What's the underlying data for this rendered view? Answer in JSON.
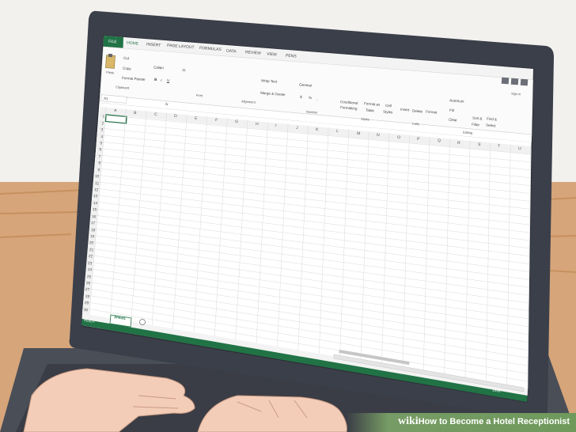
{
  "ribbon_tabs": [
    "FILE",
    "HOME",
    "INSERT",
    "PAGE LAYOUT",
    "FORMULAS",
    "DATA",
    "REVIEW",
    "VIEW",
    "PENS"
  ],
  "sign_in": "Sign in",
  "clipboard": {
    "paste": "Paste",
    "cut": "Cut",
    "copy": "Copy",
    "format_painter": "Format Painter",
    "group": "Clipboard"
  },
  "font": {
    "name": "Calibri",
    "size": "11",
    "group": "Font",
    "bold": "B",
    "italic": "I",
    "underline": "U"
  },
  "alignment": {
    "wrap_text": "Wrap Text",
    "merge_center": "Merge & Center",
    "group": "Alignment"
  },
  "number": {
    "format": "General",
    "currency": "$",
    "percent": "%",
    "comma": ",",
    "group": "Number"
  },
  "styles": {
    "conditional": "Conditional",
    "formatting": "Formatting",
    "format_as": "Format as",
    "table": "Table",
    "cell": "Cell",
    "cell_styles": "Styles",
    "group": "Styles"
  },
  "cells": {
    "insert": "Insert",
    "delete": "Delete",
    "format": "Format",
    "group": "Cells"
  },
  "editing": {
    "autosum": "AutoSum",
    "fill": "Fill",
    "clear": "Clear",
    "sort": "Sort &",
    "filter": "Filter",
    "find": "Find &",
    "select": "Select",
    "group": "Editing"
  },
  "name_box": "A1",
  "fx": "fx",
  "columns": [
    "A",
    "B",
    "C",
    "D",
    "E",
    "F",
    "G",
    "H",
    "I",
    "J",
    "K",
    "L",
    "M",
    "N",
    "O",
    "P",
    "Q",
    "R",
    "S",
    "T",
    "U"
  ],
  "rows": [
    "1",
    "2",
    "3",
    "4",
    "5",
    "6",
    "7",
    "8",
    "9",
    "10",
    "11",
    "12",
    "13",
    "14",
    "15",
    "16",
    "17",
    "18",
    "19",
    "20",
    "21",
    "22",
    "23",
    "24",
    "25",
    "26",
    "27",
    "28",
    "29",
    "30"
  ],
  "sheet_tab": "Sheet1",
  "status": "READY",
  "zoom": "100%",
  "watermark": {
    "wiki": "wiki",
    "title": "How to Become a Hotel Receptionist"
  },
  "colors": {
    "excel_green": "#217346",
    "laptop_bezel": "#3b3f4a",
    "desk": "#d6a57a",
    "wall": "#f2f1ee",
    "skin": "#f4cdb8"
  }
}
